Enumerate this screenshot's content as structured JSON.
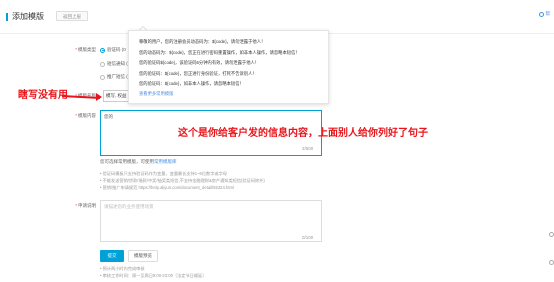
{
  "header": {
    "title": "添加模版",
    "back_label": "返回上层",
    "help_label": "帮"
  },
  "form": {
    "type_label": "模版类型",
    "type_options": [
      "验证码 (0",
      "短信通知 (",
      "推广短信 ("
    ],
    "name_label": "模版名称",
    "name_value": "模写, 权益",
    "content_label": "模版内容",
    "content_value": "您的",
    "content_count": "2/500",
    "hint_prefix": "您可选择常用模版，可使用",
    "hint_link": "常用模版库",
    "tips": [
      "• 验证码模板只支持验证码作为变量，变量最长支持1~6位数字或字母",
      "• 不能发送营销/贷款/借款/中奖/抽奖类短信,不支持金融理财&房产通知类短信(验证码除外)",
      "• 营销/推广申请规范 https://help.aliyun.com/document_detail/55324.html"
    ],
    "desc_label": "申请说明",
    "desc_placeholder": "请描述您的业务使用场景",
    "desc_count": "0/100",
    "submit_label": "提交",
    "draft_label": "模版预览",
    "footer_lines": [
      "• 预计两小时内完成审核",
      "• 审核工作时间：周一至周日9:00-23:00（法定节日顺延）"
    ]
  },
  "dropdown": {
    "items": [
      "尊敬的用户，您的注册会员动态码为：${code}，请勿泄露于他人！",
      "您的动态码为：${code}，您正在进行密码重置操作，如非本人操作，请忽略本短信！",
      "您的验证码${code}，该验证码5分钟内有效，请勿泄露于他人！",
      "您的验证码：${code}，您正进行身份验证，打死不告诉别人！",
      "您的验证码：${code}，如非本人操作，请忽略本短信！"
    ],
    "more_label": "查看更多常用模版"
  },
  "annotations": {
    "left_note": "瞎写没有用",
    "center_note": "这个是你给客户发的信息内容，上面别人给你列好了句子"
  },
  "colors": {
    "accent": "#00a1d6",
    "annotation": "#e8161c",
    "link": "#4a90e2"
  }
}
